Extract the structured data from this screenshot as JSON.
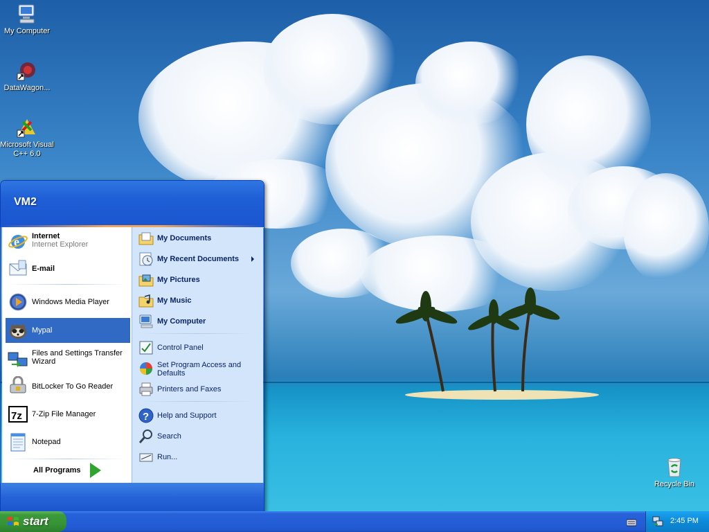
{
  "desktop": {
    "icons": [
      {
        "label": "My Computer",
        "icon": "my-computer-icon"
      },
      {
        "label": "DataWagon...",
        "icon": "datawagon-shortcut-icon"
      },
      {
        "label": "Microsoft Visual C++ 6.0",
        "icon": "visual-cpp-shortcut-icon"
      },
      {
        "label": "Recycle Bin",
        "icon": "recycle-bin-icon"
      }
    ]
  },
  "start_menu": {
    "user": "VM2",
    "left_items": [
      {
        "title": "Internet",
        "subtitle": "Internet Explorer",
        "icon": "internet-explorer-icon"
      },
      {
        "title": "E-mail",
        "icon": "email-icon"
      },
      {
        "title": "Windows Media Player",
        "icon": "media-player-icon"
      },
      {
        "title": "Mypal",
        "icon": "mypal-icon",
        "selected": true
      },
      {
        "title": "Files and Settings Transfer Wizard",
        "icon": "transfer-wizard-icon"
      },
      {
        "title": "BitLocker To Go Reader",
        "icon": "bitlocker-icon"
      },
      {
        "title": "7-Zip File Manager",
        "icon": "7zip-icon"
      },
      {
        "title": "Notepad",
        "icon": "notepad-icon"
      }
    ],
    "all_programs": "All Programs",
    "right_items": [
      {
        "title": "My Documents",
        "icon": "my-documents-icon"
      },
      {
        "title": "My Recent Documents",
        "icon": "recent-documents-icon",
        "submenu": true
      },
      {
        "title": "My Pictures",
        "icon": "my-pictures-icon"
      },
      {
        "title": "My Music",
        "icon": "my-music-icon"
      },
      {
        "title": "My Computer",
        "icon": "my-computer-icon"
      },
      {
        "title": "Control Panel",
        "icon": "control-panel-icon"
      },
      {
        "title": "Set Program Access and Defaults",
        "icon": "program-access-icon"
      },
      {
        "title": "Printers and Faxes",
        "icon": "printer-icon"
      },
      {
        "title": "Help and Support",
        "icon": "help-icon"
      },
      {
        "title": "Search",
        "icon": "search-icon"
      },
      {
        "title": "Run...",
        "icon": "run-icon"
      }
    ]
  },
  "taskbar": {
    "start_label": "start",
    "clock": "2:45 PM"
  },
  "colors": {
    "taskbar_blue": "#245ed6",
    "start_green": "#369436",
    "selection": "#316ac5"
  }
}
